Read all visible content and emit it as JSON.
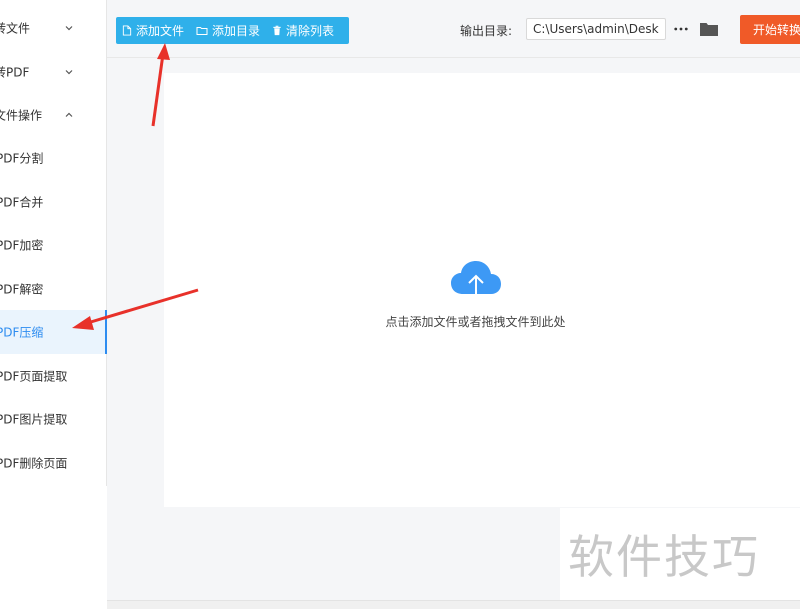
{
  "sidebar": {
    "groups": [
      {
        "label": "转文件",
        "expanded": false
      },
      {
        "label": "转PDF",
        "expanded": false
      },
      {
        "label": "文件操作",
        "expanded": true
      }
    ],
    "items": [
      {
        "label": "PDF分割"
      },
      {
        "label": "PDF合并"
      },
      {
        "label": "PDF加密"
      },
      {
        "label": "PDF解密"
      },
      {
        "label": "PDF压缩",
        "active": true
      },
      {
        "label": "PDF页面提取"
      },
      {
        "label": "PDF图片提取"
      },
      {
        "label": "PDF删除页面"
      }
    ]
  },
  "toolbar": {
    "add_file": "添加文件",
    "add_dir": "添加目录",
    "clear_list": "清除列表",
    "output_label": "输出目录:",
    "output_path": "C:\\Users\\admin\\Deskto",
    "start": "开始转换"
  },
  "dropzone": {
    "hint": "点击添加文件或者拖拽文件到此处"
  },
  "watermark": "软件技巧",
  "colors": {
    "primary": "#2fb0ea",
    "accent": "#2d8cf0",
    "start": "#f05a28",
    "arrow": "#e8312a"
  },
  "icons": [
    "file-icon",
    "folder-outline-icon",
    "trash-icon",
    "more-icon",
    "folder-icon",
    "cloud-upload-icon",
    "chevron-down-icon",
    "chevron-up-icon"
  ]
}
